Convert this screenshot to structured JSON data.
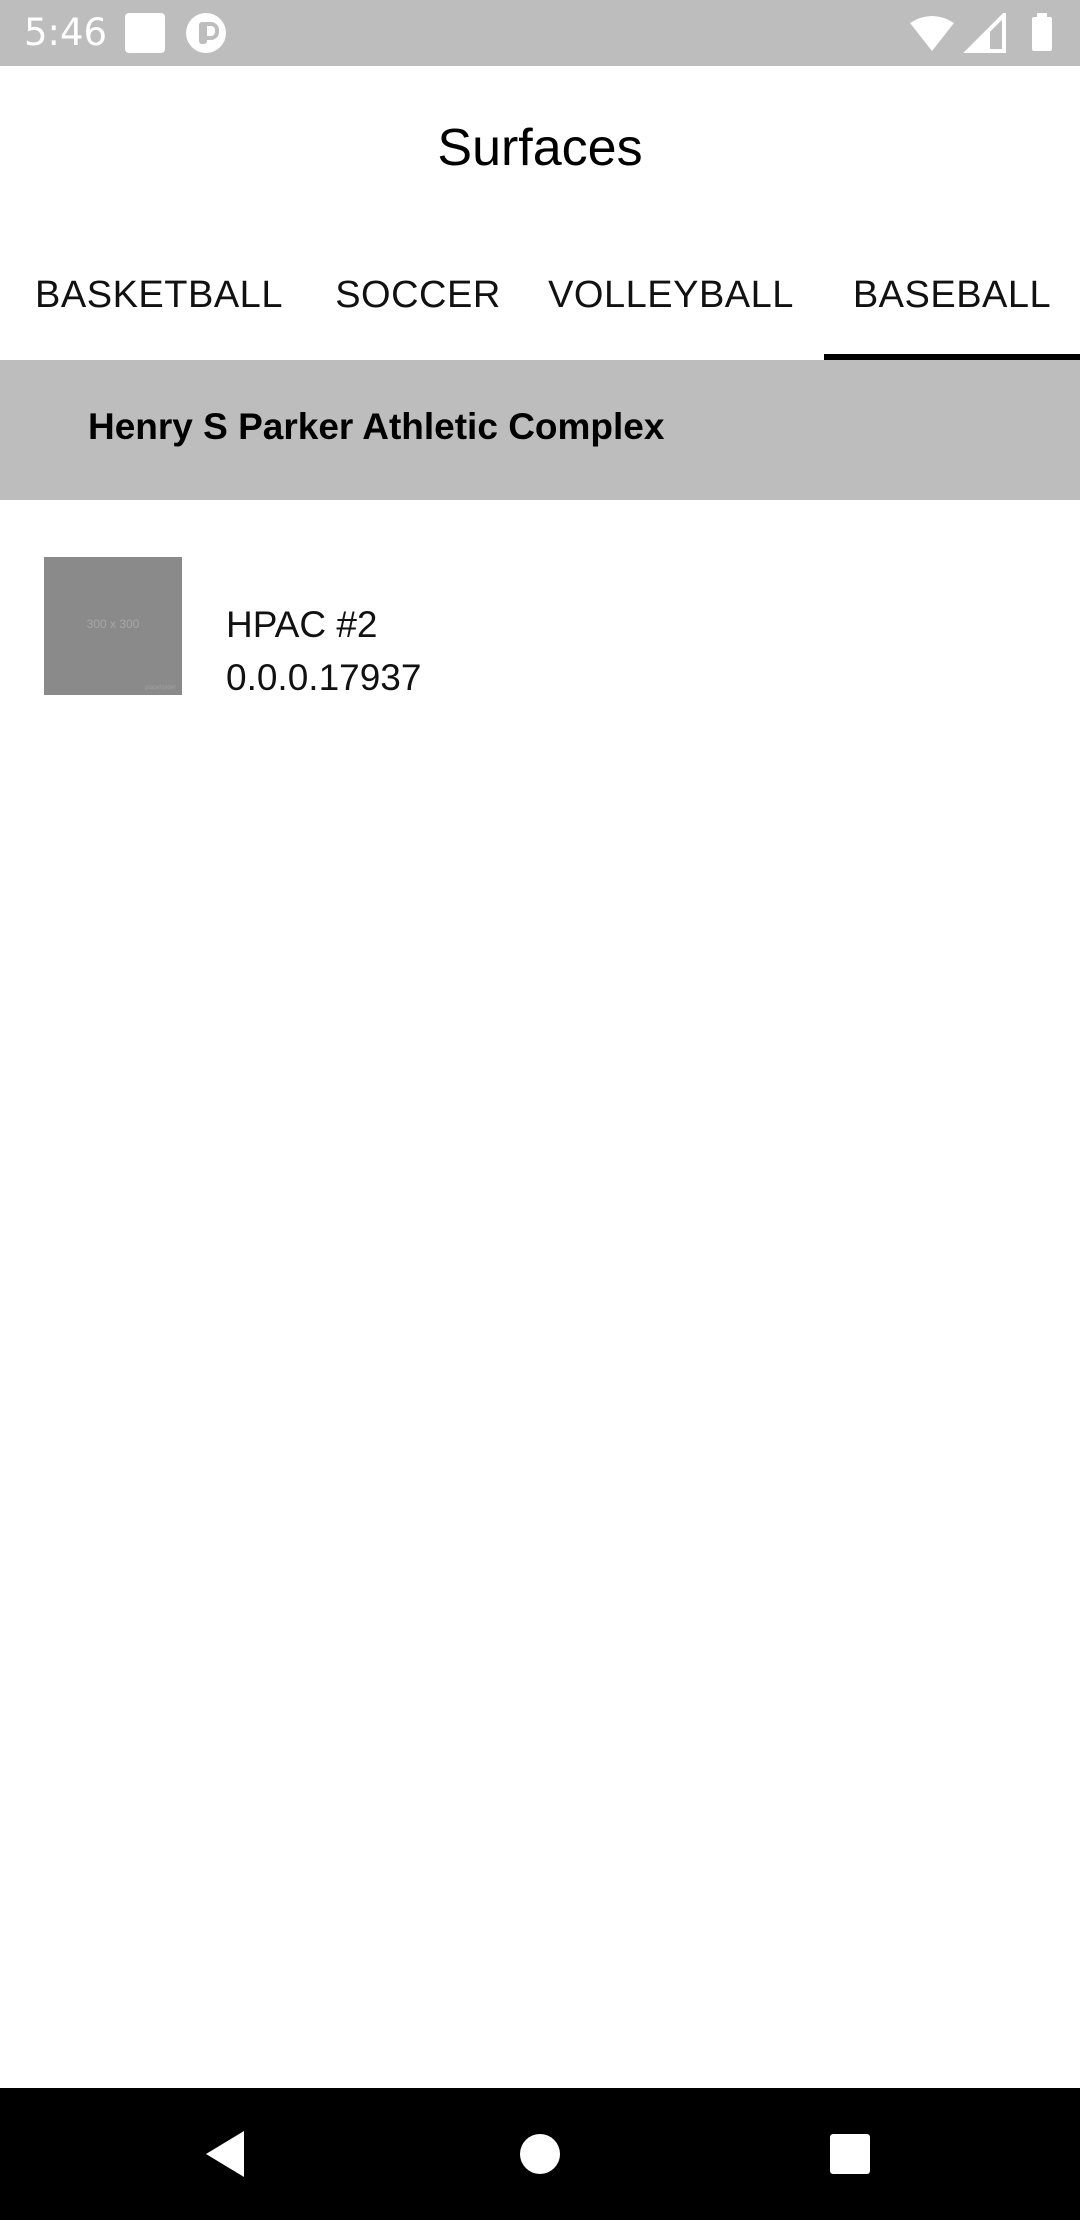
{
  "status_bar": {
    "time": "5:46",
    "icons": [
      "notification-square-icon",
      "app-notification-icon",
      "wifi-icon",
      "signal-icon",
      "battery-icon"
    ]
  },
  "header": {
    "title": "Surfaces"
  },
  "tabs": [
    {
      "label": "BASKETBALL",
      "active": false
    },
    {
      "label": "SOCCER",
      "active": false
    },
    {
      "label": "VOLLEYBALL",
      "active": false
    },
    {
      "label": "BASEBALL",
      "active": true
    }
  ],
  "section": {
    "title": "Henry S Parker Athletic Complex"
  },
  "items": [
    {
      "thumbnail_text": "300 x 300",
      "thumbnail_subtext": "placeholder",
      "name": "HPAC #2",
      "subtitle": "0.0.0.17937"
    }
  ],
  "nav": {
    "icons": [
      "back-icon",
      "home-icon",
      "recents-icon"
    ]
  },
  "colors": {
    "status_bar": "#bdbdbd",
    "section_header": "#bdbdbd",
    "thumbnail": "#8a8a8a",
    "nav_bar": "#000000",
    "tab_indicator": "#000000"
  }
}
